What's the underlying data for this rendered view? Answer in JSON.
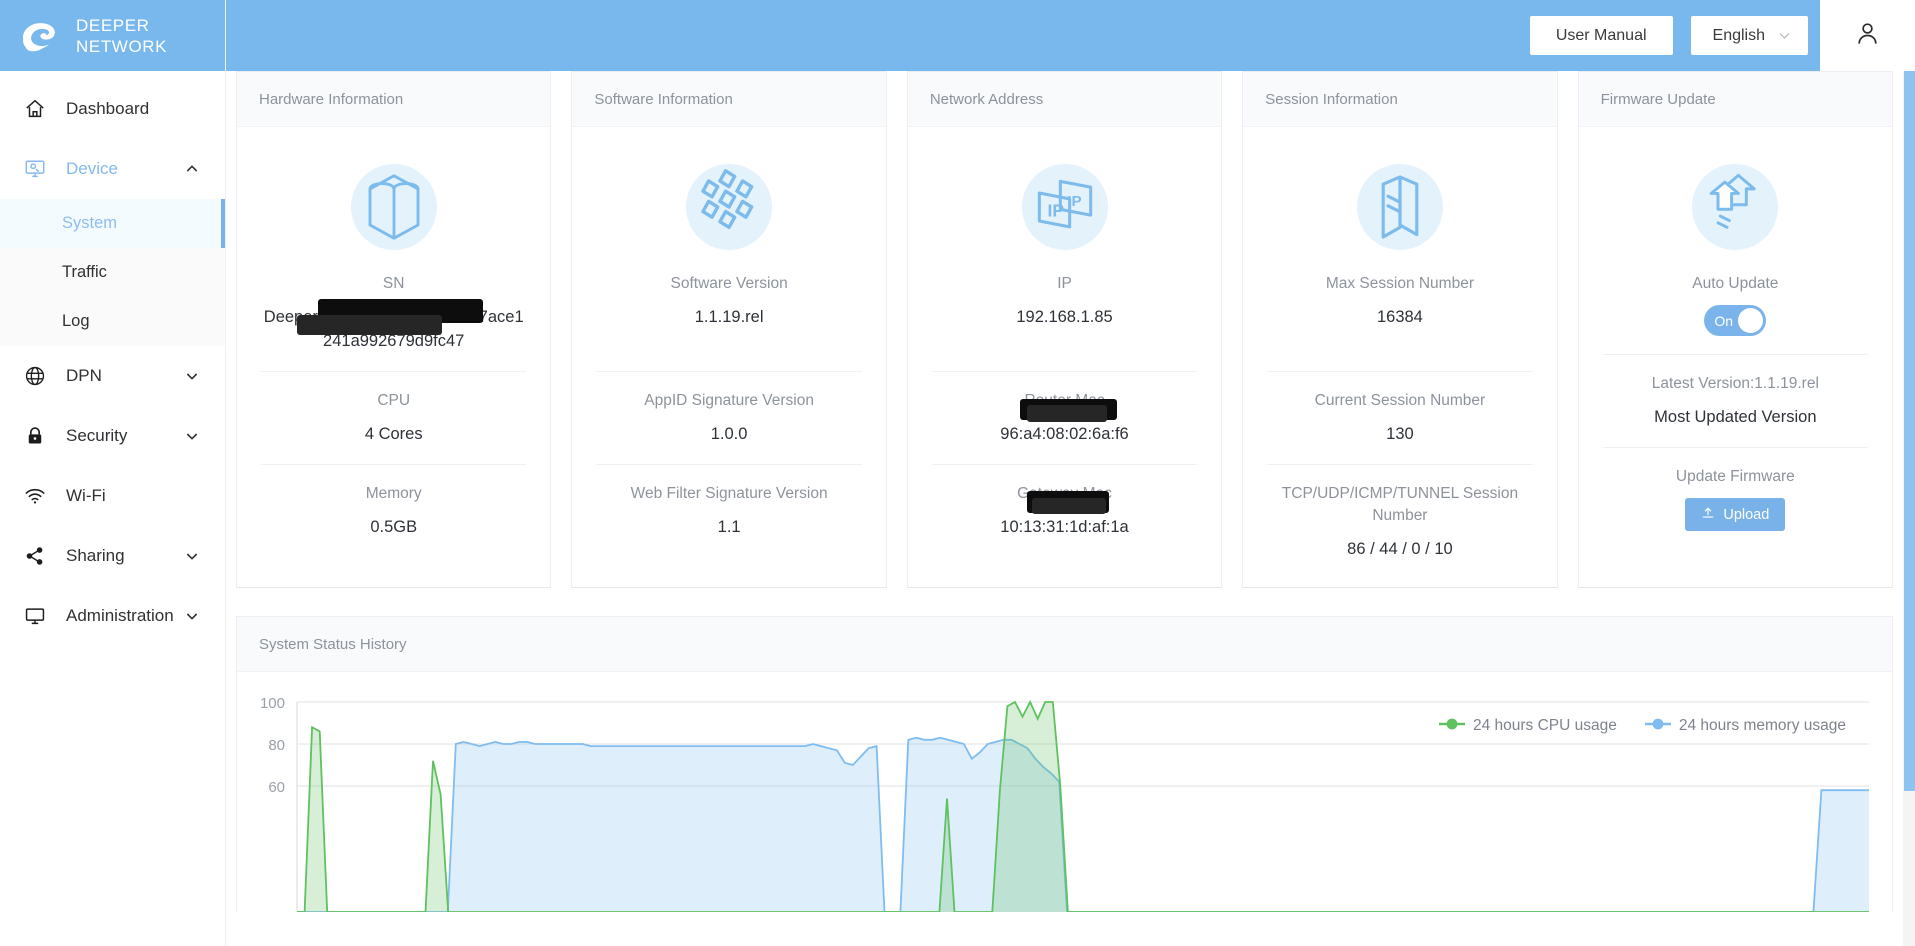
{
  "brand": {
    "line1": "DEEPER",
    "line2": "NETWORK",
    "logo_icon": "spiral-logo-icon",
    "bg": "#79b8ed"
  },
  "topbar": {
    "user_manual_label": "User Manual",
    "language_value": "English",
    "language_chevron_icon": "chevron-down-icon",
    "account_icon": "user-account-icon"
  },
  "sidebar": {
    "items": [
      {
        "label": "Dashboard",
        "icon": "home-icon",
        "chevron": "",
        "state": "normal"
      },
      {
        "label": "Device",
        "icon": "device-monitor-icon",
        "chevron": "chevron-up-icon",
        "state": "open"
      },
      {
        "label": "DPN",
        "icon": "globe-icon",
        "chevron": "chevron-down-icon",
        "state": "normal"
      },
      {
        "label": "Security",
        "icon": "lock-icon",
        "chevron": "chevron-down-icon",
        "state": "normal"
      },
      {
        "label": "Wi-Fi",
        "icon": "wifi-icon",
        "chevron": "",
        "state": "normal"
      },
      {
        "label": "Sharing",
        "icon": "share-nodes-icon",
        "chevron": "chevron-down-icon",
        "state": "normal"
      },
      {
        "label": "Administration",
        "icon": "desktop-icon",
        "chevron": "chevron-down-icon",
        "state": "normal"
      }
    ],
    "sub_items": [
      {
        "label": "System",
        "active": true
      },
      {
        "label": "Traffic",
        "active": false
      },
      {
        "label": "Log",
        "active": false
      }
    ]
  },
  "cards": [
    {
      "title": "Hardware Information",
      "icon": "hardware-cube-icon",
      "fields": [
        {
          "label": "SN",
          "value": "Deeper-Wire-HWA-8dcabab07ace1241a992679d9fc47",
          "redacted": true
        },
        {
          "label": "CPU",
          "value": "4 Cores",
          "redacted": false
        },
        {
          "label": "Memory",
          "value": "0.5GB",
          "redacted": false
        }
      ]
    },
    {
      "title": "Software Information",
      "icon": "software-honeycomb-icon",
      "fields": [
        {
          "label": "Software Version",
          "value": "1.1.19.rel",
          "redacted": false
        },
        {
          "label": "AppID Signature Version",
          "value": "1.0.0",
          "redacted": false
        },
        {
          "label": "Web Filter Signature Version",
          "value": "1.1",
          "redacted": false
        }
      ]
    },
    {
      "title": "Network Address",
      "icon": "ip-cards-icon",
      "fields": [
        {
          "label": "IP",
          "value": "192.168.1.85",
          "redacted": false
        },
        {
          "label": "Router Mac",
          "value": "96:a4:08:02:6a:f6",
          "redacted": true
        },
        {
          "label": "Gateway Mac",
          "value": "10:13:31:1d:af:1a",
          "redacted": true
        }
      ]
    },
    {
      "title": "Session Information",
      "icon": "session-pages-icon",
      "fields": [
        {
          "label": "Max Session Number",
          "value": "16384",
          "redacted": false
        },
        {
          "label": "Current Session Number",
          "value": "130",
          "redacted": false
        },
        {
          "label": "TCP/UDP/ICMP/TUNNEL Session Number",
          "value": "86 / 44 / 0 / 10",
          "redacted": false
        }
      ]
    },
    {
      "title": "Firmware Update",
      "icon": "firmware-arrows-up-icon",
      "fields": [
        {
          "label": "Auto Update",
          "toggle_state": "On"
        },
        {
          "label": "Latest Version:1.1.19.rel",
          "value": "Most Updated Version"
        },
        {
          "label": "Update Firmware",
          "button_label": "Upload",
          "button_icon": "upload-icon"
        }
      ]
    }
  ],
  "history": {
    "title": "System Status History"
  },
  "chart_data": {
    "type": "area",
    "title": "System Status History",
    "xlabel": "",
    "ylabel": "",
    "ylim": [
      0,
      100
    ],
    "yticks": [
      60,
      80,
      100
    ],
    "grid": true,
    "legend_position": "top-right",
    "colors": {
      "cpu": "#5fc15f",
      "memory": "#7fbdf0"
    },
    "series": [
      {
        "name": "24 hours CPU usage",
        "color": "#5fc15f",
        "values": [
          0,
          0,
          88,
          86,
          0,
          0,
          0,
          0,
          0,
          0,
          0,
          0,
          0,
          0,
          0,
          0,
          0,
          0,
          72,
          56,
          0,
          0,
          0,
          0,
          0,
          0,
          0,
          0,
          0,
          0,
          0,
          0,
          0,
          0,
          0,
          0,
          0,
          0,
          0,
          0,
          0,
          0,
          0,
          0,
          0,
          0,
          0,
          0,
          0,
          0,
          0,
          0,
          0,
          0,
          0,
          0,
          0,
          0,
          0,
          0,
          0,
          0,
          0,
          0,
          0,
          0,
          0,
          0,
          0,
          0,
          0,
          0,
          0,
          0,
          0,
          0,
          0,
          0,
          0,
          0,
          0,
          0,
          0,
          0,
          0,
          0,
          54,
          0,
          0,
          0,
          0,
          0,
          0,
          58,
          98,
          100,
          93,
          100,
          92,
          100,
          100,
          60,
          0,
          0,
          0,
          0,
          0,
          0,
          0,
          0,
          0,
          0,
          0,
          0,
          0,
          0,
          0,
          0,
          0,
          0,
          0,
          0,
          0,
          0,
          0,
          0,
          0,
          0,
          0,
          0,
          0,
          0,
          0,
          0,
          0,
          0,
          0,
          0,
          0,
          0,
          0,
          0,
          0,
          0,
          0,
          0,
          0,
          0,
          0,
          0,
          0,
          0,
          0,
          0,
          0,
          0,
          0,
          0,
          0,
          0,
          0,
          0,
          0,
          0,
          0,
          0,
          0,
          0,
          0,
          0,
          0,
          0,
          0,
          0,
          0,
          0,
          0,
          0,
          0,
          0,
          0,
          0,
          0,
          0,
          0,
          0,
          0,
          0,
          0,
          0,
          0,
          0,
          0,
          0,
          0,
          0,
          0,
          0,
          0,
          0,
          0,
          0,
          0,
          0,
          0,
          0,
          0,
          0,
          0
        ]
      },
      {
        "name": "24 hours memory usage",
        "color": "#7fbdf0",
        "values": [
          0,
          0,
          0,
          0,
          0,
          0,
          0,
          0,
          0,
          0,
          0,
          0,
          0,
          0,
          0,
          0,
          0,
          0,
          0,
          0,
          80,
          81,
          80,
          79,
          80,
          81,
          80,
          80,
          81,
          81,
          80,
          80,
          80,
          80,
          80,
          80,
          80,
          79,
          79,
          79,
          79,
          79,
          79,
          79,
          79,
          79,
          79,
          79,
          79,
          79,
          79,
          79,
          79,
          79,
          79,
          79,
          79,
          79,
          79,
          79,
          79,
          79,
          79,
          79,
          79,
          80,
          79,
          78,
          77,
          71,
          70,
          74,
          78,
          79,
          0,
          0,
          0,
          82,
          83,
          82,
          82,
          83,
          82,
          81,
          80,
          73,
          76,
          80,
          81,
          82,
          82,
          80,
          78,
          73,
          69,
          66,
          62,
          0,
          0,
          0,
          0,
          0,
          0,
          0,
          0,
          0,
          0,
          0,
          0,
          0,
          0,
          0,
          0,
          0,
          0,
          0,
          0,
          0,
          0,
          0,
          0,
          0,
          0,
          0,
          0,
          0,
          0,
          0,
          0,
          0,
          0,
          0,
          0,
          0,
          0,
          0,
          0,
          0,
          0,
          0,
          0,
          0,
          0,
          0,
          0,
          0,
          0,
          0,
          0,
          0,
          0,
          0,
          0,
          0,
          0,
          0,
          0,
          0,
          0,
          0,
          0,
          0,
          0,
          0,
          0,
          0,
          0,
          0,
          0,
          0,
          0,
          0,
          0,
          0,
          0,
          0,
          0,
          0,
          0,
          0,
          0,
          0,
          0,
          0,
          0,
          0,
          0,
          0,
          0,
          0,
          0,
          0,
          58,
          58,
          58,
          58,
          58,
          58,
          58
        ]
      }
    ]
  }
}
